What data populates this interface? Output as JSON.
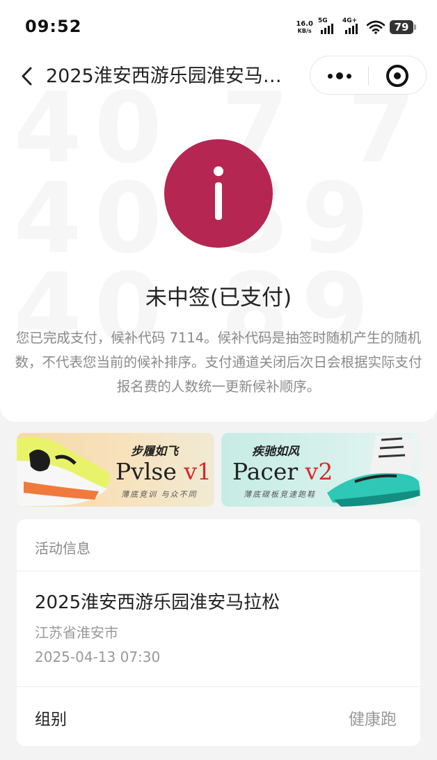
{
  "status_bar": {
    "time": "09:52",
    "net_speed_value": "16.0",
    "net_speed_unit": "KB/s",
    "signal_1_label": "5G",
    "signal_2_label": "4G+",
    "battery": "79"
  },
  "nav": {
    "title": "2025淮安西游乐园淮安马…",
    "back_icon": "chevron-left-icon",
    "more_icon": "more-dots-icon",
    "close_icon": "target-circle-icon"
  },
  "watermark": "40 7 7 40 59 40 89",
  "result": {
    "icon": "info-icon",
    "icon_color": "#b52652",
    "title": "未中签(已支付)",
    "description": "您已完成支付，候补代码 7114。候补代码是抽签时随机产生的随机数，不代表您当前的候补排序。支付通道关闭后次日会根据实际支付报名费的人数统一更新候补顺序。"
  },
  "banners": [
    {
      "tagline": "步履如飞",
      "name": "Pvlse",
      "version": " v1",
      "subtitle": "薄底竞训  与众不同"
    },
    {
      "tagline": "疾驰如风",
      "name": "Pacer",
      "version": " v2",
      "subtitle": "薄底碳板竞速跑鞋"
    }
  ],
  "activity": {
    "header": "活动信息",
    "event_name": "2025淮安西游乐园淮安马拉松",
    "location": "江苏省淮安市",
    "datetime": "2025-04-13 07:30",
    "group_label": "组别",
    "group_value": "健康跑"
  }
}
